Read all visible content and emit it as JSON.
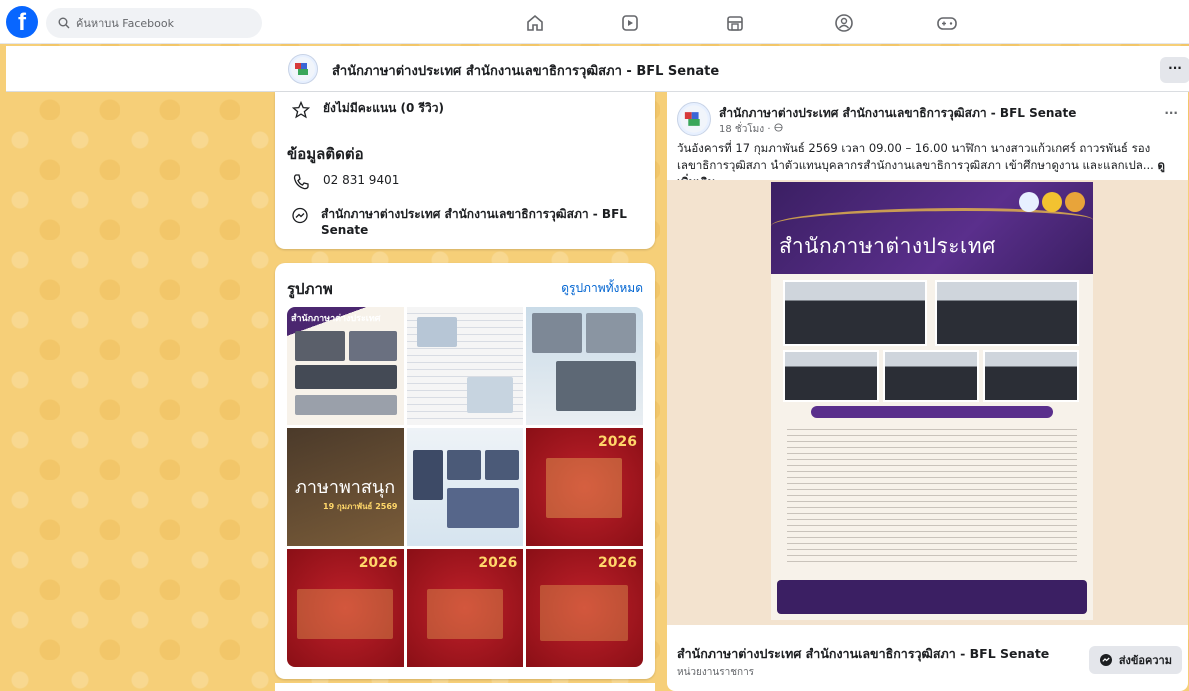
{
  "topbar": {
    "logo": "f",
    "search_placeholder": "ค้นหาบน Facebook",
    "nav_icons": [
      "home-icon",
      "video-icon",
      "marketplace-icon",
      "groups-icon",
      "gaming-icon"
    ]
  },
  "page_header": {
    "title": "สำนักภาษาต่างประเทศ สำนักงานเลขาธิการวุฒิสภา - BFL Senate",
    "more": "···"
  },
  "info_card": {
    "rating": "ยังไม่มีคะแนน (0 รีวิว)",
    "contact_title": "ข้อมูลติดต่อ",
    "phone": "02 831 9401",
    "messenger": "สำนักภาษาต่างประเทศ สำนักงานเลขาธิการวุฒิสภา - BFL Senate"
  },
  "photos_card": {
    "title": "รูปภาพ",
    "see_all": "ดูรูปภาพทั้งหมด",
    "tiles": [
      {
        "label": "สำนักภาษาต่างประเทศ"
      },
      {
        "label": ""
      },
      {
        "label": ""
      },
      {
        "label": "ภาษาพาสนุก",
        "sub": "19 กุมภาพันธ์ 2569"
      },
      {
        "label": ""
      },
      {
        "label": "2026"
      },
      {
        "label": "2026"
      },
      {
        "label": "2026"
      },
      {
        "label": "2026"
      }
    ]
  },
  "post": {
    "author": "สำนักภาษาต่างประเทศ สำนักงานเลขาธิการวุฒิสภา - BFL Senate",
    "time": "18 ชั่วโมง · ",
    "more": "···",
    "text": "วันอังคารที่ 17 กุมภาพันธ์ 2569 เวลา 09.00 – 16.00 นาฬิกา นางสาวแก้วเกศร์ ถาวรพันธ์ รองเลขาธิการวุฒิสภา นำตัวแทนบุคลากรสำนักงานเลขาธิการวุฒิสภา เข้าศึกษาดูงาน และแลกเปล... ",
    "see_more": "ดูเพิ่มเติม",
    "poster_title": "สำนักภาษาต่างประเทศ",
    "footer_title": "สำนักภาษาต่างประเทศ สำนักงานเลขาธิการวุฒิสภา - BFL Senate",
    "footer_sub": "หน่วยงานราชการ",
    "message_button": "ส่งข้อความ"
  },
  "colors": {
    "facebook_blue": "#0866ff",
    "link_blue": "#0064d1",
    "poster_purple": "#3b1f63",
    "background_gold": "#f6cf78"
  }
}
